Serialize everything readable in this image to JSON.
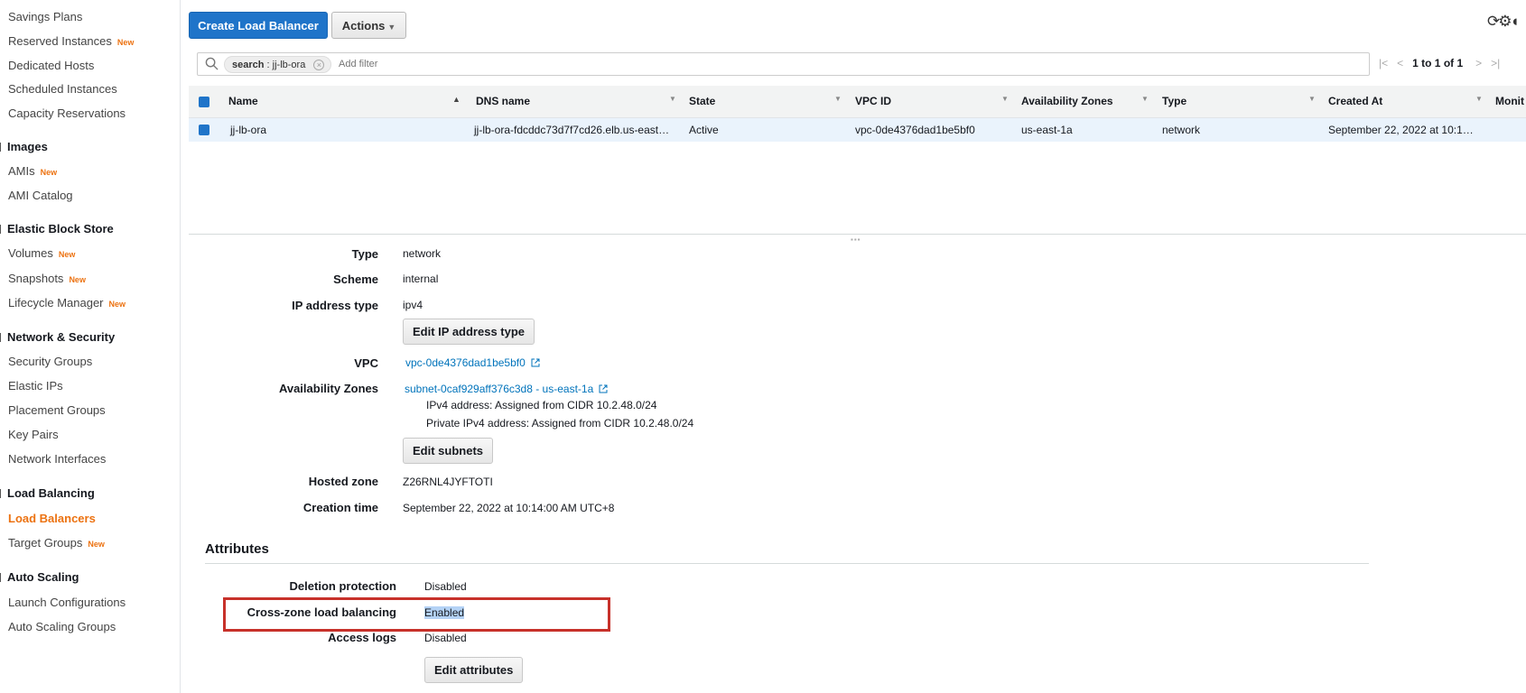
{
  "sidebar": {
    "items": [
      {
        "label": "Savings Plans",
        "badge": ""
      },
      {
        "label": "Reserved Instances",
        "badge": "New"
      },
      {
        "label": "Dedicated Hosts",
        "badge": ""
      },
      {
        "label": "Scheduled Instances",
        "badge": ""
      },
      {
        "label": "Capacity Reservations",
        "badge": ""
      }
    ],
    "sections": [
      {
        "title": "Images",
        "items": [
          {
            "label": "AMIs",
            "badge": "New"
          },
          {
            "label": "AMI Catalog",
            "badge": ""
          }
        ]
      },
      {
        "title": "Elastic Block Store",
        "items": [
          {
            "label": "Volumes",
            "badge": "New"
          },
          {
            "label": "Snapshots",
            "badge": "New"
          },
          {
            "label": "Lifecycle Manager",
            "badge": "New"
          }
        ]
      },
      {
        "title": "Network & Security",
        "items": [
          {
            "label": "Security Groups",
            "badge": ""
          },
          {
            "label": "Elastic IPs",
            "badge": ""
          },
          {
            "label": "Placement Groups",
            "badge": ""
          },
          {
            "label": "Key Pairs",
            "badge": ""
          },
          {
            "label": "Network Interfaces",
            "badge": ""
          }
        ]
      },
      {
        "title": "Load Balancing",
        "items": [
          {
            "label": "Load Balancers",
            "badge": "",
            "active": true
          },
          {
            "label": "Target Groups",
            "badge": "New"
          }
        ]
      },
      {
        "title": "Auto Scaling",
        "items": [
          {
            "label": "Launch Configurations",
            "badge": ""
          },
          {
            "label": "Auto Scaling Groups",
            "badge": ""
          }
        ]
      }
    ]
  },
  "toolbar": {
    "create_label": "Create Load Balancer",
    "actions_label": "Actions",
    "icons": [
      "refresh-icon",
      "settings-icon",
      "help-icon"
    ]
  },
  "filter": {
    "token_key": "search",
    "token_value": ": jj-lb-ora",
    "placeholder": "Add filter"
  },
  "pager": {
    "text": "1 to 1 of 1"
  },
  "table": {
    "columns": [
      "Name",
      "DNS name",
      "State",
      "VPC ID",
      "Availability Zones",
      "Type",
      "Created At",
      "Monit"
    ],
    "rows": [
      [
        "jj-lb-ora",
        "jj-lb-ora-fdcddc73d7f7cd26.elb.us-east…",
        "Active",
        "vpc-0de4376dad1be5bf0",
        "us-east-1a",
        "network",
        "September 22, 2022 at 10:1…",
        ""
      ]
    ]
  },
  "details": {
    "type_label": "Type",
    "type_value": "network",
    "scheme_label": "Scheme",
    "scheme_value": "internal",
    "ip_label": "IP address type",
    "ip_value": "ipv4",
    "edit_ip_label": "Edit IP address type",
    "vpc_label": "VPC",
    "vpc_value": "vpc-0de4376dad1be5bf0",
    "az_label": "Availability Zones",
    "az_value": "subnet-0caf929aff376c3d8 - us-east-1a",
    "az_ipv4": "IPv4 address: Assigned from CIDR 10.2.48.0/24",
    "az_private": "Private IPv4 address: Assigned from CIDR 10.2.48.0/24",
    "edit_subnets_label": "Edit subnets",
    "hosted_label": "Hosted zone",
    "hosted_value": "Z26RNL4JYFTOTI",
    "creation_label": "Creation time",
    "creation_value": "September 22, 2022 at 10:14:00 AM UTC+8"
  },
  "attributes": {
    "title": "Attributes",
    "deletion_label": "Deletion protection",
    "deletion_value": "Disabled",
    "crosszone_label": "Cross-zone load balancing",
    "crosszone_value": "Enabled",
    "logs_label": "Access logs",
    "logs_value": "Disabled",
    "edit_label": "Edit attributes",
    "highlight_color": "#c7312a"
  },
  "colors": {
    "primary": "#1f74c9",
    "accent": "#ec7211",
    "link": "#0073bb"
  }
}
